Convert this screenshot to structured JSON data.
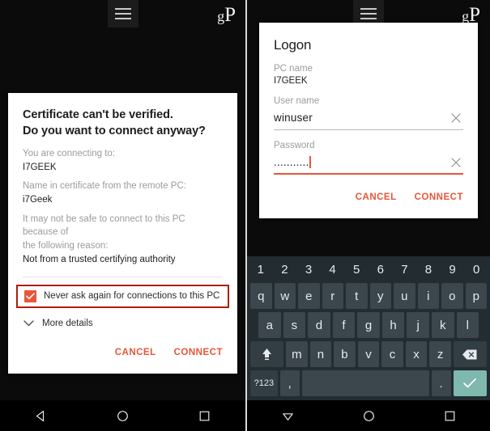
{
  "brand": {
    "logo_text_small": "g",
    "logo_text_large": "P"
  },
  "left_phone": {
    "appbar": {
      "menu_icon": "hamburger-menu-icon"
    },
    "cert_dialog": {
      "title_line1": "Certificate can't be verified.",
      "title_line2": "Do you want to connect anyway?",
      "connecting_label": "You are connecting to:",
      "connecting_value": "I7GEEK",
      "cert_name_label": "Name in certificate from the remote PC:",
      "cert_name_value": "i7Geek",
      "reason_label_line1": "It may not be safe to connect to this PC because of",
      "reason_label_line2": "the following reason:",
      "reason_value": "Not from a trusted certifying authority",
      "never_ask_label": "Never ask again for connections to this PC",
      "never_ask_checked": true,
      "more_details_label": "More details",
      "cancel_label": "CANCEL",
      "connect_label": "CONNECT",
      "highlight_color": "#b01c10",
      "accent_color": "#e8553a"
    },
    "navbar": {
      "back": "back-triangle-icon",
      "home": "home-circle-icon",
      "recents": "recents-square-icon"
    }
  },
  "right_phone": {
    "appbar": {
      "menu_icon": "hamburger-menu-icon"
    },
    "logon_dialog": {
      "title": "Logon",
      "pc_name_label": "PC name",
      "pc_name_value": "I7GEEK",
      "user_name_label": "User name",
      "user_name_value": "winuser",
      "password_label": "Password",
      "password_value": "...........",
      "password_char_count": 11,
      "cancel_label": "CANCEL",
      "connect_label": "CONNECT",
      "accent_color": "#e8553a"
    },
    "keyboard": {
      "number_row": [
        "1",
        "2",
        "3",
        "4",
        "5",
        "6",
        "7",
        "8",
        "9",
        "0"
      ],
      "row1": [
        "q",
        "w",
        "e",
        "r",
        "t",
        "y",
        "u",
        "i",
        "o",
        "p"
      ],
      "row2": [
        "a",
        "s",
        "d",
        "f",
        "g",
        "h",
        "j",
        "k",
        "l"
      ],
      "row3": [
        "z",
        "x",
        "c",
        "v",
        "b",
        "n",
        "m"
      ],
      "shift_label": "shift-icon",
      "backspace_label": "backspace-icon",
      "symbols_label": "?123",
      "comma_label": ",",
      "space_label": "",
      "period_label": ".",
      "enter_label": "check-icon",
      "enter_color": "#7fb8ae",
      "key_color": "#3b464d",
      "background_color": "#232c31"
    },
    "navbar": {
      "back": "keyboard-dismiss-triangle-icon",
      "home": "home-circle-icon",
      "recents": "recents-square-icon"
    }
  }
}
